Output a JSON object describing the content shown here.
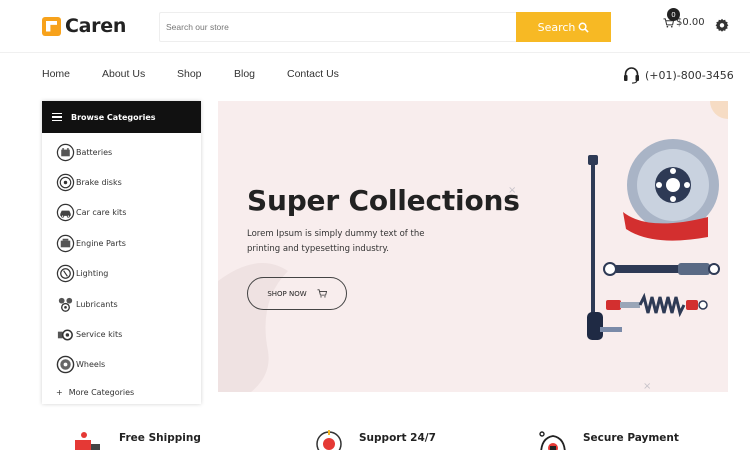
{
  "header": {
    "logo_text": "Caren",
    "search_placeholder": "Search our store",
    "search_button": "Search",
    "cart_count": "0",
    "cart_total": "$0.00"
  },
  "nav": {
    "items": [
      "Home",
      "About Us",
      "Shop",
      "Blog",
      "Contact Us"
    ],
    "phone": "(+01)-800-3456"
  },
  "sidebar": {
    "title": "Browse Categories",
    "categories": [
      {
        "label": "Batteries",
        "icon": "battery-icon"
      },
      {
        "label": "Brake disks",
        "icon": "brake-disk-icon"
      },
      {
        "label": "Car care kits",
        "icon": "car-care-icon"
      },
      {
        "label": "Engine Parts",
        "icon": "engine-icon"
      },
      {
        "label": "Lighting",
        "icon": "lighting-icon"
      },
      {
        "label": "Lubricants",
        "icon": "lubricant-icon"
      },
      {
        "label": "Service kits",
        "icon": "service-kit-icon"
      },
      {
        "label": "Wheels",
        "icon": "wheel-icon"
      }
    ],
    "more": "More Categories"
  },
  "hero": {
    "title": "Super Collections",
    "text": "Lorem Ipsum is simply dummy text of the printing and typesetting industry.",
    "button": "SHOP NOW"
  },
  "features": [
    {
      "title": "Free Shipping",
      "icon": "truck-icon"
    },
    {
      "title": "Support 24/7",
      "icon": "support-icon"
    },
    {
      "title": "Secure Payment",
      "icon": "secure-payment-icon"
    }
  ],
  "colors": {
    "accent": "#f7b924",
    "logo": "#f7a21b",
    "sidebar_head": "#111111",
    "hero_bg": "#f8eded"
  }
}
